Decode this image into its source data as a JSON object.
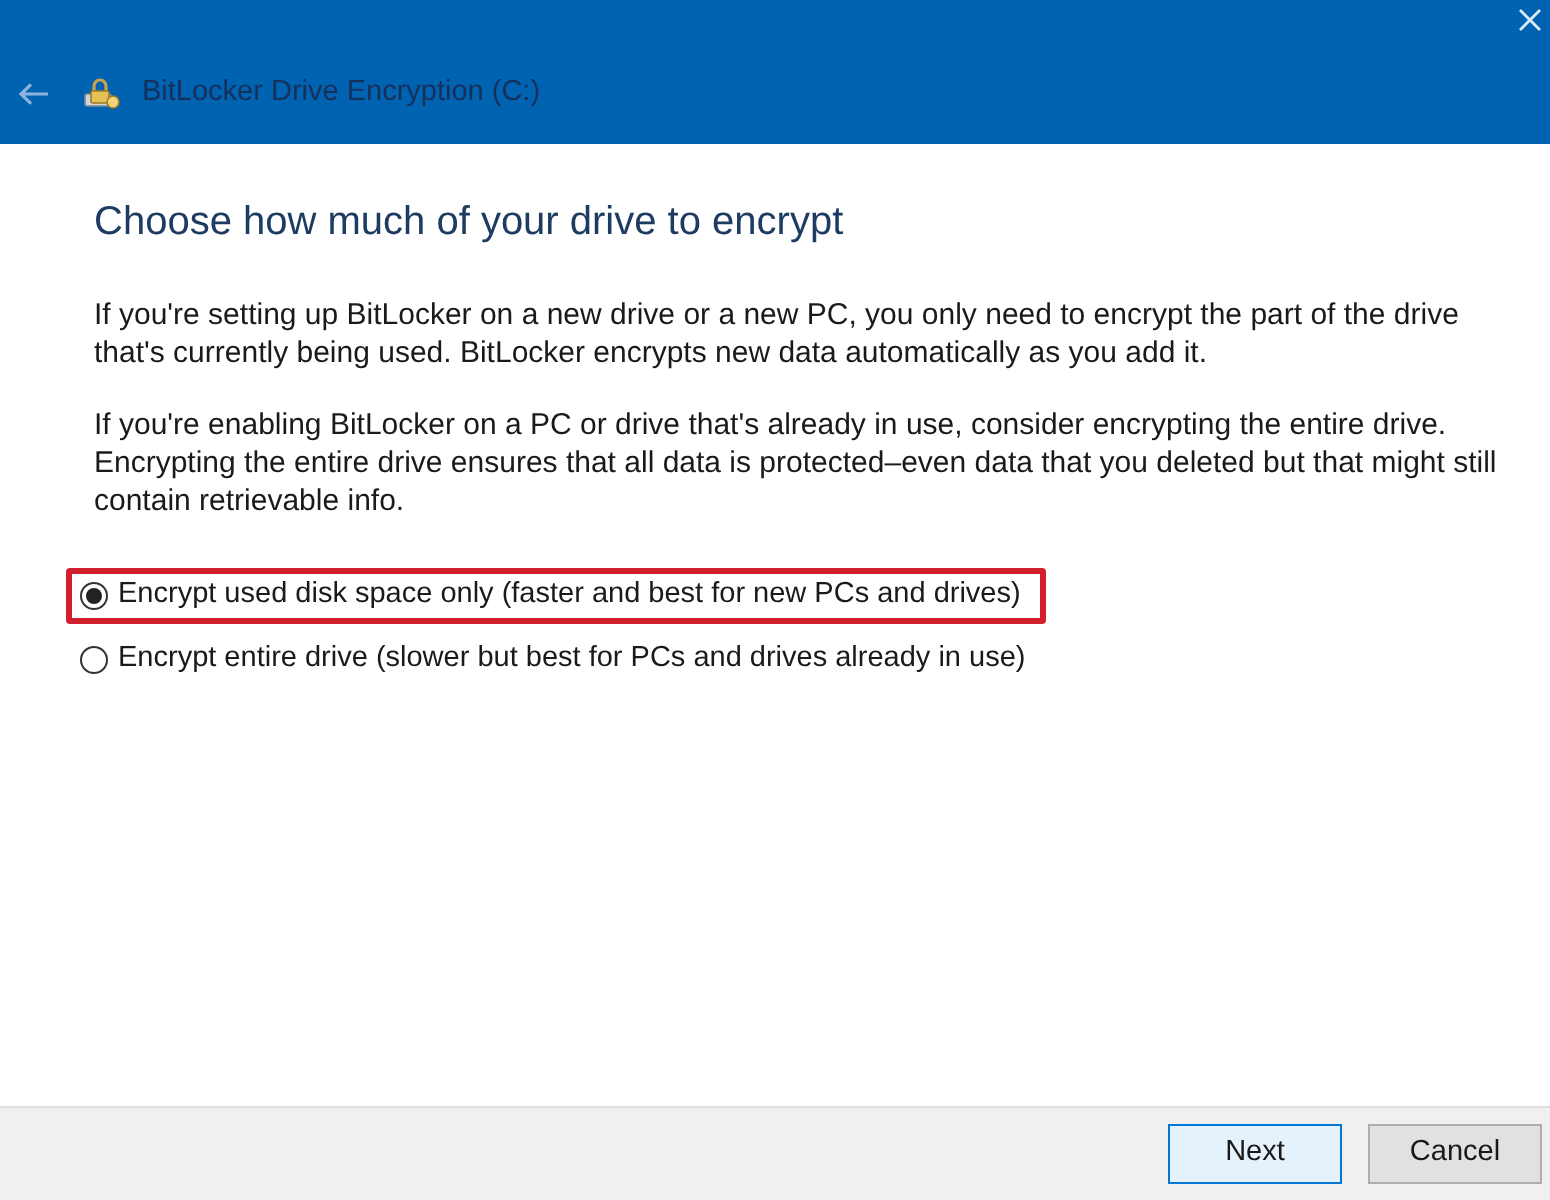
{
  "window": {
    "title": "BitLocker Drive Encryption (C:)"
  },
  "heading": "Choose how much of your drive to encrypt",
  "paragraphs": [
    "If you're setting up BitLocker on a new drive or a new PC, you only need to encrypt the part of the drive that's currently being used. BitLocker encrypts new data automatically as you add it.",
    "If you're enabling BitLocker on a PC or drive that's already in use, consider encrypting the entire drive. Encrypting the entire drive ensures that all data is protected–even data that you deleted but that might still contain retrievable info."
  ],
  "options": [
    {
      "label": "Encrypt used disk space only (faster and best for new PCs and drives)",
      "selected": true,
      "highlighted": true
    },
    {
      "label": "Encrypt entire drive (slower but best for PCs and drives already in use)",
      "selected": false,
      "highlighted": false
    }
  ],
  "buttons": [
    {
      "label": "Next",
      "kind": "default"
    },
    {
      "label": "Cancel",
      "kind": "normal"
    }
  ]
}
